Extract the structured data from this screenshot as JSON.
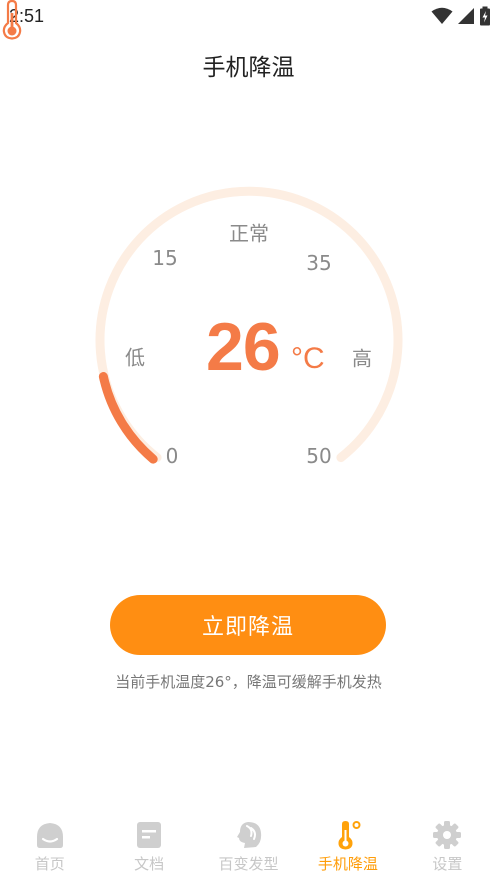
{
  "status_bar": {
    "time": "2:51"
  },
  "page_title": "手机降温",
  "gauge": {
    "top_label": "正常",
    "low_label": "低",
    "high_label": "高",
    "tick_15": "15",
    "tick_35": "35",
    "tick_0": "0",
    "tick_50": "50",
    "value": "26",
    "unit": "°C",
    "level_min": 0,
    "level_max": 50,
    "level": 26
  },
  "action": {
    "button_label": "立即降温",
    "hint": "当前手机温度26°，降温可缓解手机发热"
  },
  "tabs": [
    {
      "label": "首页",
      "icon": "home-icon"
    },
    {
      "label": "文档",
      "icon": "document-icon"
    },
    {
      "label": "百变发型",
      "icon": "hairstyle-icon"
    },
    {
      "label": "手机降温",
      "icon": "thermometer-icon",
      "active": true
    },
    {
      "label": "设置",
      "icon": "gear-icon"
    }
  ],
  "colors": {
    "accent": "#ff8e12",
    "temperature": "#f47b47",
    "gauge_track": "#fdeee2",
    "tab_active": "#ff9d0a",
    "tab_inactive": "#c7c7c7"
  }
}
